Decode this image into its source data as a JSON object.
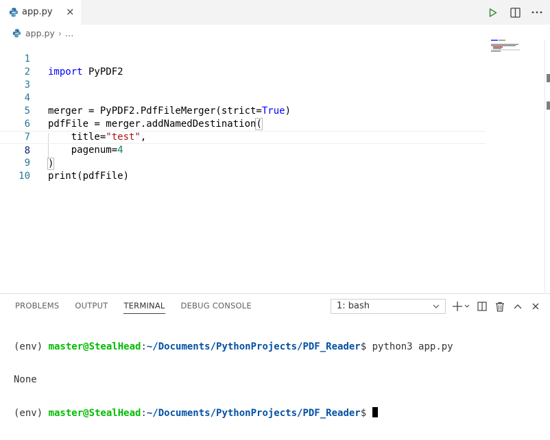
{
  "tab": {
    "filename": "app.py",
    "close_glyph": "×"
  },
  "toolbar": {
    "run_icon": "play-icon",
    "split_icon": "split-editor-icon",
    "more_icon": "more-icon"
  },
  "breadcrumb": {
    "file": "app.py",
    "more": "…"
  },
  "code": {
    "line_numbers": [
      "1",
      "2",
      "3",
      "4",
      "5",
      "6",
      "7",
      "8",
      "9",
      "10"
    ],
    "active_line": 8
  },
  "panel": {
    "tabs": [
      "PROBLEMS",
      "OUTPUT",
      "TERMINAL",
      "DEBUG CONSOLE"
    ],
    "active_tab": "TERMINAL",
    "terminal_select": "1: bash"
  },
  "terminal": {
    "env": "(env) ",
    "user": "master@StealHead",
    "colon": ":",
    "path": "~/Documents/PythonProjects/PDF_Reader",
    "prompt": "$ ",
    "command": "python3 app.py",
    "output": "None"
  },
  "colors": {
    "keyword": "#0000ff",
    "string": "#a31515",
    "number": "#098658",
    "terminal_user": "#00bc00",
    "terminal_path": "#0451a5"
  }
}
